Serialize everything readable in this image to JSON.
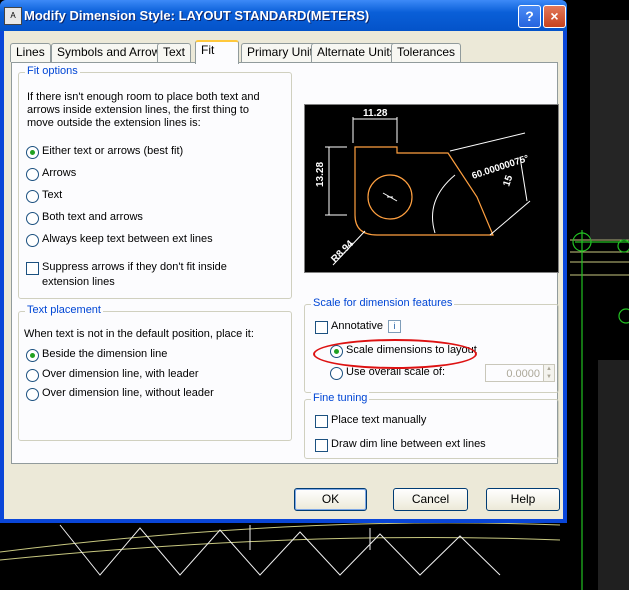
{
  "dialog": {
    "app_icon_text": "A",
    "title": "Modify Dimension Style: LAYOUT STANDARD(METERS)",
    "help_glyph": "?",
    "close_glyph": "×"
  },
  "tabs": [
    "Lines",
    "Symbols and Arrows",
    "Text",
    "Fit",
    "Primary Units",
    "Alternate Units",
    "Tolerances"
  ],
  "active_tab": "Fit",
  "fit_options": {
    "legend": "Fit options",
    "description": [
      "If there isn't enough room to place both text and",
      "arrows inside extension lines, the first thing to",
      "move outside the extension lines is:"
    ],
    "options": [
      "Either text or arrows (best fit)",
      "Arrows",
      "Text",
      "Both text and arrows",
      "Always keep text between ext lines"
    ],
    "selected_index": 0,
    "suppress_label": [
      "Suppress arrows if they don't fit inside",
      "extension lines"
    ]
  },
  "text_placement": {
    "legend": "Text placement",
    "prompt": "When text is not in the default position, place it:",
    "options": [
      "Beside the dimension line",
      "Over dimension line, with leader",
      "Over dimension line, without leader"
    ],
    "selected_index": 0
  },
  "preview": {
    "dim_top": "11.28",
    "dim_left": "13.28",
    "dim_angle": "60.00000075°",
    "dim_right": "15",
    "dim_radius": "R8.94"
  },
  "scale": {
    "legend": "Scale for dimension features",
    "annotative_label": "Annotative",
    "info_glyph": "i",
    "scale_to_layout_label": "Scale dimensions to layout",
    "overall_scale_label": "Use overall scale of:",
    "overall_scale_value": "0.0000",
    "selected": "scale_to_layout"
  },
  "fine_tuning": {
    "legend": "Fine tuning",
    "place_text_manually": "Place text manually",
    "draw_dim_line": "Draw dim line between ext lines"
  },
  "buttons": {
    "ok": "OK",
    "cancel": "Cancel",
    "help": "Help"
  },
  "colors": {
    "title_blue": "#0a5fd8",
    "legend_blue": "#0046d5",
    "highlight_red": "#dd1111",
    "preview_yellow": "#ffff00",
    "preview_orange": "#ffa040"
  }
}
